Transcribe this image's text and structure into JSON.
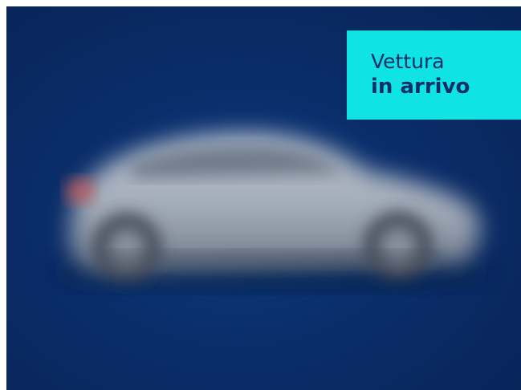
{
  "banner": {
    "line1": "Vettura",
    "line2": "in arrivo"
  },
  "colors": {
    "background": "#0a2d69",
    "badge": "#10e3e3",
    "badge_text": "#0a2d6b",
    "car_body": "#aab3c0"
  },
  "image": {
    "subject": "blurred-car-silhouette-icon"
  }
}
